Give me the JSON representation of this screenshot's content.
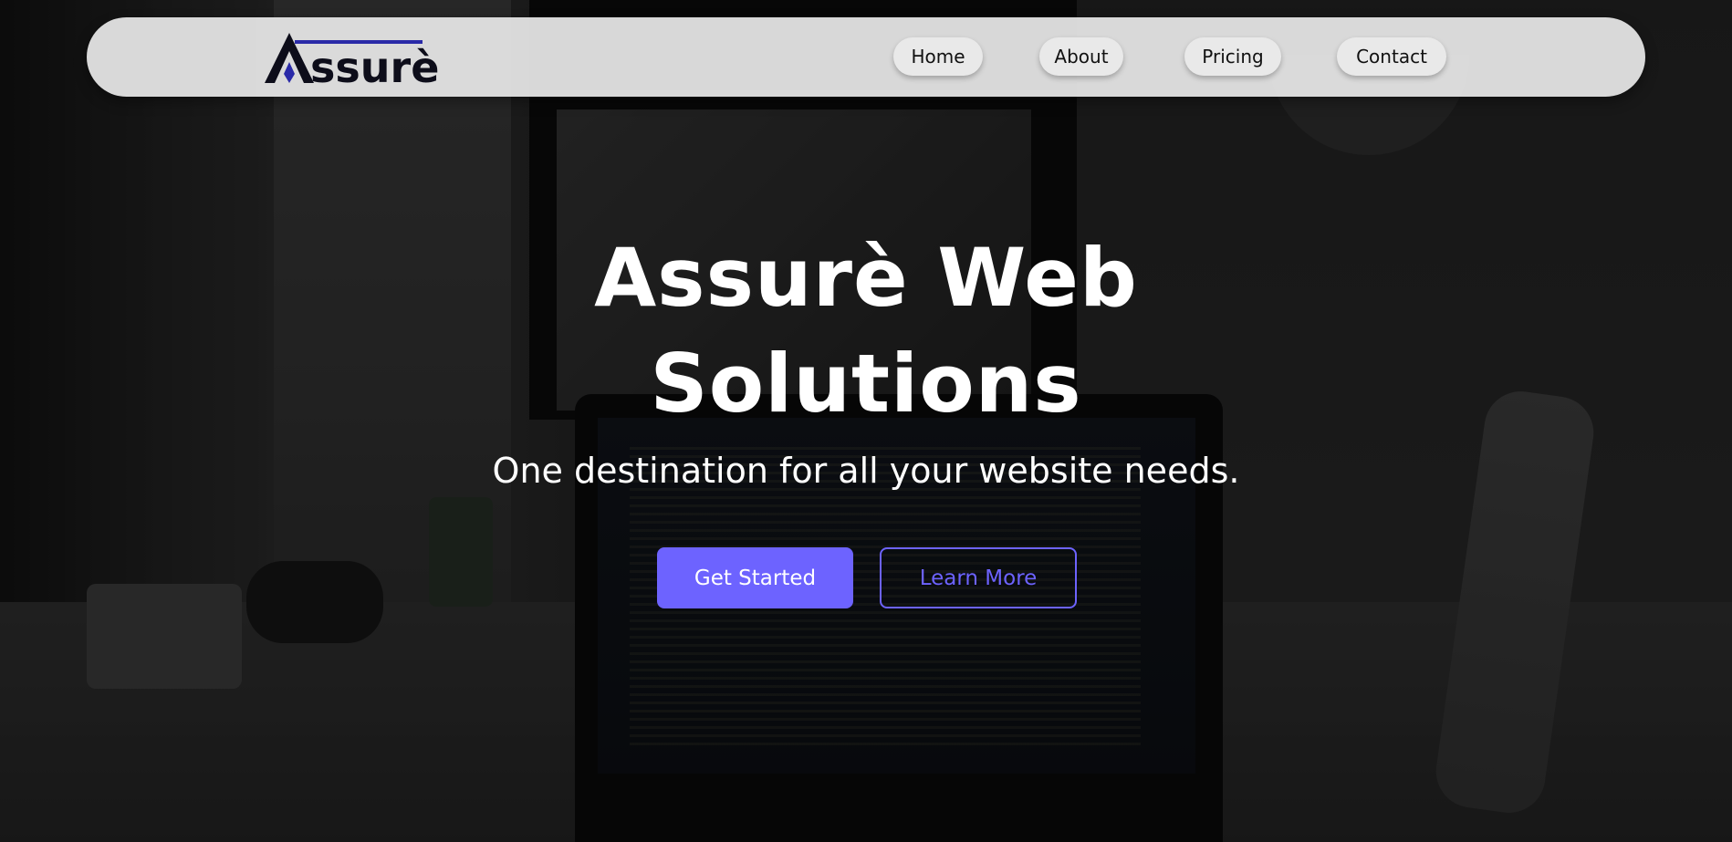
{
  "navbar": {
    "logo_text": "Assurè",
    "items": [
      {
        "label": "Home"
      },
      {
        "label": "About"
      },
      {
        "label": "Pricing"
      },
      {
        "label": "Contact"
      }
    ]
  },
  "hero": {
    "title_line1": "Assurè Web",
    "title_line2": "Solutions",
    "subtitle": "One destination for all your website needs.",
    "primary_button": "Get Started",
    "secondary_button": "Learn More"
  },
  "colors": {
    "accent": "#6d63ff",
    "logo_blue": "#2a2aa8",
    "navbar_bg": "#e8e8e8"
  }
}
